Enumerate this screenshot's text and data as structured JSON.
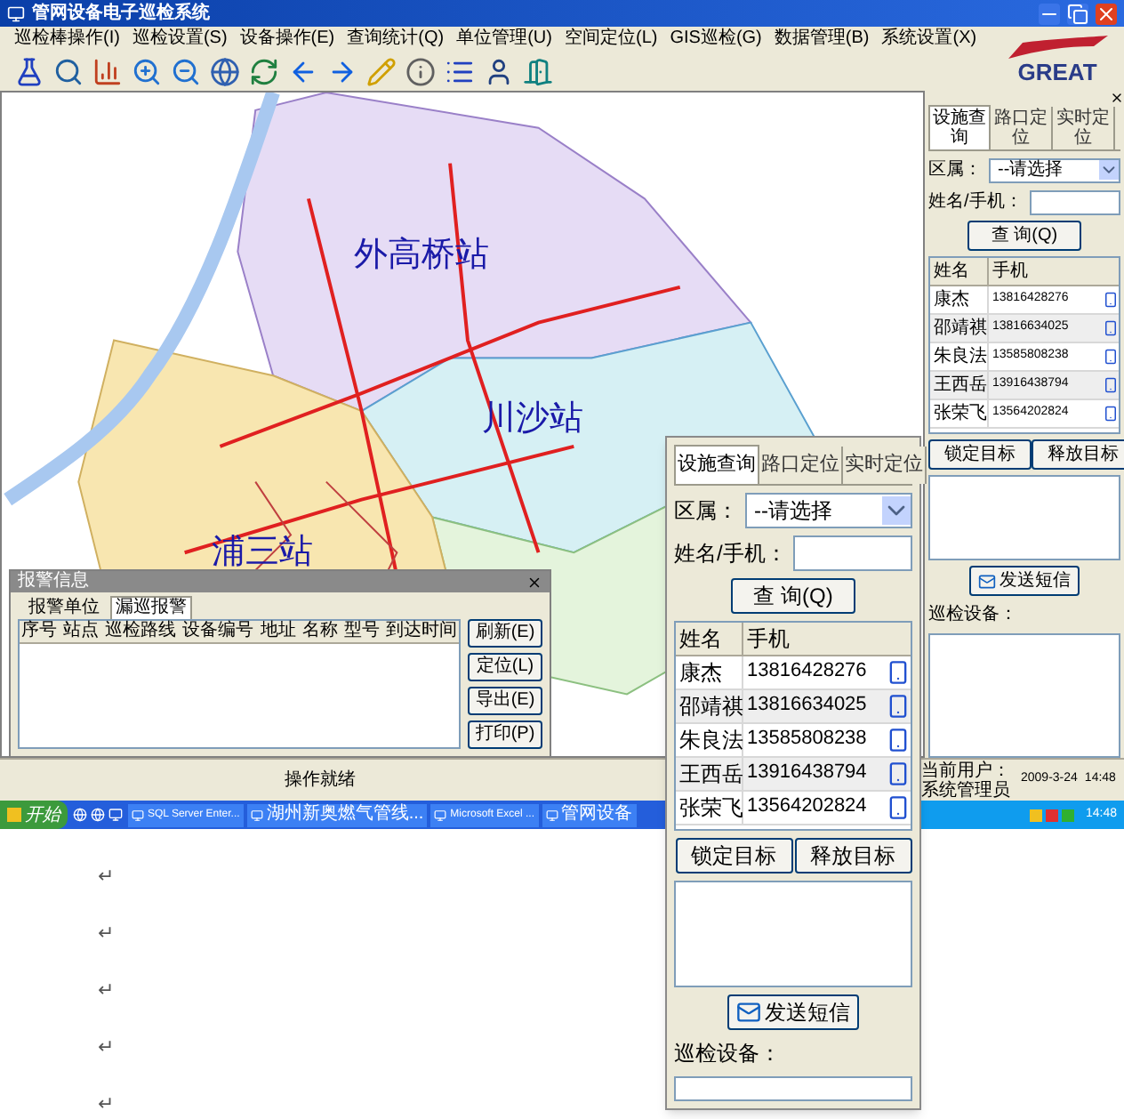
{
  "window": {
    "title": "管网设备电子巡检系统"
  },
  "menu": [
    "巡检棒操作(I)",
    "巡检设置(S)",
    "设备操作(E)",
    "查询统计(Q)",
    "单位管理(U)",
    "空间定位(L)",
    "GIS巡检(G)",
    "数据管理(B)",
    "系统设置(X)"
  ],
  "logo": {
    "text": "GREAT"
  },
  "map": {
    "labels": [
      "外高桥站",
      "川沙站",
      "浦三站"
    ]
  },
  "side_panel": {
    "tabs": [
      {
        "label": "设施查询",
        "selected": true
      },
      {
        "label": "路口定位",
        "selected": false
      },
      {
        "label": "实时定位",
        "selected": false
      }
    ],
    "district_label": "区属：",
    "district_value": "--请选择",
    "name_label": "姓名/手机：",
    "query_button": "查 询(Q)",
    "columns": [
      "姓名",
      "手机"
    ],
    "rows": [
      {
        "name": "康杰",
        "phone": "13816428276"
      },
      {
        "name": "邵靖祺",
        "phone": "13816634025"
      },
      {
        "name": "朱良法",
        "phone": "13585808238"
      },
      {
        "name": "王西岳",
        "phone": "13916438794"
      },
      {
        "name": "张荣飞",
        "phone": "13564202824"
      }
    ],
    "lock_button": "锁定目标",
    "release_button": "释放目标",
    "sms_button": "发送短信",
    "device_label": "巡检设备："
  },
  "alarm_dialog": {
    "title": "报警信息",
    "tabs": [
      {
        "label": "报警单位",
        "selected": false
      },
      {
        "label": "漏巡报警",
        "selected": true
      }
    ],
    "columns": [
      "序号",
      "站点",
      "巡检路线",
      "设备编号",
      "地址",
      "名称",
      "型号",
      "到达时间"
    ],
    "buttons": [
      "刷新(E)",
      "定位(L)",
      "导出(E)",
      "打印(P)"
    ]
  },
  "status_bar": {
    "message": "操作就绪",
    "user": "当前用户：系统管理员",
    "date": "2009-3-24",
    "time": "14:48"
  },
  "taskbar": {
    "start": "开始",
    "tasks": [
      "SQL Server Enter...",
      "湖州新奥燃气管线...",
      "Microsoft Excel ...",
      "管网设备"
    ],
    "clock": "14:48"
  },
  "zoomed_panel": {
    "tabs": [
      {
        "label": "设施查询",
        "selected": true
      },
      {
        "label": "路口定位",
        "selected": false
      },
      {
        "label": "实时定位",
        "selected": false
      }
    ],
    "district_label": "区属：",
    "district_value": "--请选择",
    "name_label": "姓名/手机：",
    "query_button": "查 询(Q)",
    "columns": [
      "姓名",
      "手机"
    ],
    "rows": [
      {
        "name": "康杰",
        "phone": "13816428276"
      },
      {
        "name": "邵靖祺",
        "phone": "13816634025"
      },
      {
        "name": "朱良法",
        "phone": "13585808238"
      },
      {
        "name": "王西岳",
        "phone": "13916438794"
      },
      {
        "name": "张荣飞",
        "phone": "13564202824"
      }
    ],
    "lock_button": "锁定目标",
    "release_button": "释放目标",
    "sms_button": "发送短信",
    "device_label": "巡检设备："
  },
  "document": {
    "marks": [
      "↵",
      "↵",
      "↵",
      "↵",
      "↵"
    ]
  }
}
